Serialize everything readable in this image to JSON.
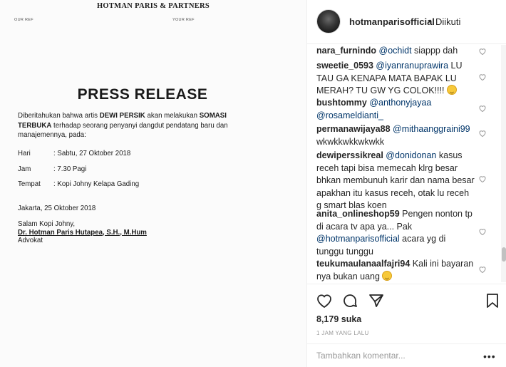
{
  "letter": {
    "letterhead": "HOTMAN PARIS & PARTNERS",
    "our_ref": "OUR REF",
    "your_ref": "YOUR REF",
    "title": "PRESS RELEASE",
    "body_1": "Diberitahukan bahwa artis ",
    "body_name": "DEWI PERSIK",
    "body_2": " akan melakukan ",
    "body_somasi_1": "SOMASI",
    "body_somasi_2": "TERBUKA",
    "body_3": " terhadap seorang penyanyi dangdut pendatang baru dan manajemennya, pada:",
    "rows": [
      {
        "label": "Hari",
        "value": ": Sabtu, 27 Oktober 2018"
      },
      {
        "label": "Jam",
        "value": ": 7.30 Pagi"
      },
      {
        "label": "Tempat",
        "value": ": Kopi Johny Kelapa Gading"
      }
    ],
    "place_date": "Jakarta, 25 Oktober 2018",
    "greeting": "Salam Kopi Johny,",
    "signatory": "Dr. Hotman Paris Hutapea, S.H., M.Hum",
    "role": "Advokat"
  },
  "header": {
    "username": "hotmanparisofficial",
    "separator": "•",
    "follow_status": "Diikuti"
  },
  "comments": [
    {
      "user": "nara_furnindo",
      "mention": "@ochidt",
      "text": " siappp dah"
    },
    {
      "user": "sweetie_0593",
      "mention": "@iyanranuprawira",
      "text": " LU TAU GA KENAPA MATA BAPAK LU MERAH? TU GW YG COLOK!!!! ",
      "emoji": "grin-emoji"
    },
    {
      "user": "bushtommy",
      "mention": "@anthonyjayaa",
      "mention2": "@rosameldianti_",
      "text": ""
    },
    {
      "user": "permanawijaya88",
      "mention": "@mithaanggraini99",
      "text": " wkwkkwkkwkwkk"
    },
    {
      "user": "dewiperssikreal",
      "mention": "@donidonan",
      "text": " kasus receh tapi bisa memecah klrg besar bhkan membunuh karir dan nama besar apakhan itu kasus receh, otak lu receh g smart blas koen"
    },
    {
      "user": "anita_onlineshop59",
      "text": " Pengen nonton tp di acara tv apa ya... Pak ",
      "mention_after": "@hotmanparisofficial",
      "text_after": " acara yg di tunggu tunggu"
    },
    {
      "user": "teukumaulanaalfajri94",
      "text": " Kali ini bayaran nya bukan uang ",
      "emoji": "grin-emoji"
    }
  ],
  "likes": "8,179 suka",
  "timestamp": "1 JAM YANG LALU",
  "comment_box": {
    "placeholder": "Tambahkan komentar...",
    "more": "•••"
  },
  "colors": {
    "mention": "#003569",
    "text": "#262626",
    "muted": "#999999"
  }
}
